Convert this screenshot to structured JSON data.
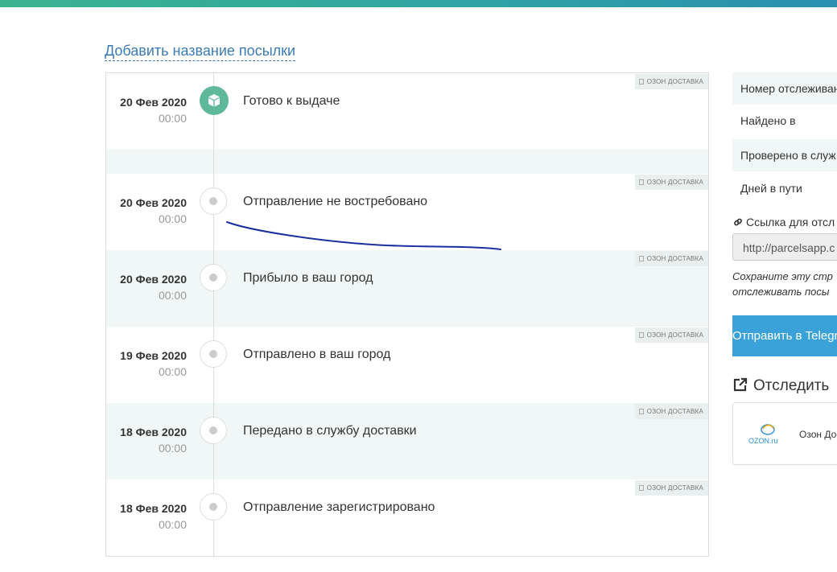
{
  "header": {
    "add_name_link": "Добавить название посылки"
  },
  "events": [
    {
      "date": "20 Фев 2020",
      "time": "00:00",
      "status": "Готово к выдаче",
      "carrier": "ОЗОН ДОСТАВКА",
      "icon": "package-icon",
      "active": true
    },
    {
      "date": "20 Фев 2020",
      "time": "00:00",
      "status": "Отправление не востребовано",
      "carrier": "ОЗОН ДОСТАВКА",
      "icon": "dot-icon",
      "active": false
    },
    {
      "date": "20 Фев 2020",
      "time": "00:00",
      "status": "Прибыло в ваш город",
      "carrier": "ОЗОН ДОСТАВКА",
      "icon": "dot-icon",
      "active": false
    },
    {
      "date": "19 Фев 2020",
      "time": "00:00",
      "status": "Отправлено в ваш город",
      "carrier": "ОЗОН ДОСТАВКА",
      "icon": "dot-icon",
      "active": false
    },
    {
      "date": "18 Фев 2020",
      "time": "00:00",
      "status": "Передано в службу доставки",
      "carrier": "ОЗОН ДОСТАВКА",
      "icon": "dot-icon",
      "active": false
    },
    {
      "date": "18 Фев 2020",
      "time": "00:00",
      "status": "Отправление зарегистрировано",
      "carrier": "ОЗОН ДОСТАВКА",
      "icon": "dot-icon",
      "active": false
    }
  ],
  "sidebar": {
    "rows": [
      "Номер отслеживан",
      "Найдено в",
      "Проверено в служ",
      "Дней в пути"
    ],
    "link_label": "Ссылка для отсл",
    "link_value": "http://parcelsapp.c",
    "save_note_line1": "Сохраните эту стр",
    "save_note_line2": "отслеживать посы",
    "telegram_button": "Отправить в Telegr",
    "track_title": "Отследить",
    "carrier_logo_text": "OZON.ru",
    "carrier_name": "Озон Дос"
  },
  "colors": {
    "accent_green": "#5fb89a",
    "link_blue": "#3a7bb5",
    "telegram_blue": "#3aa2d9",
    "shade": "#f1f7f7"
  }
}
